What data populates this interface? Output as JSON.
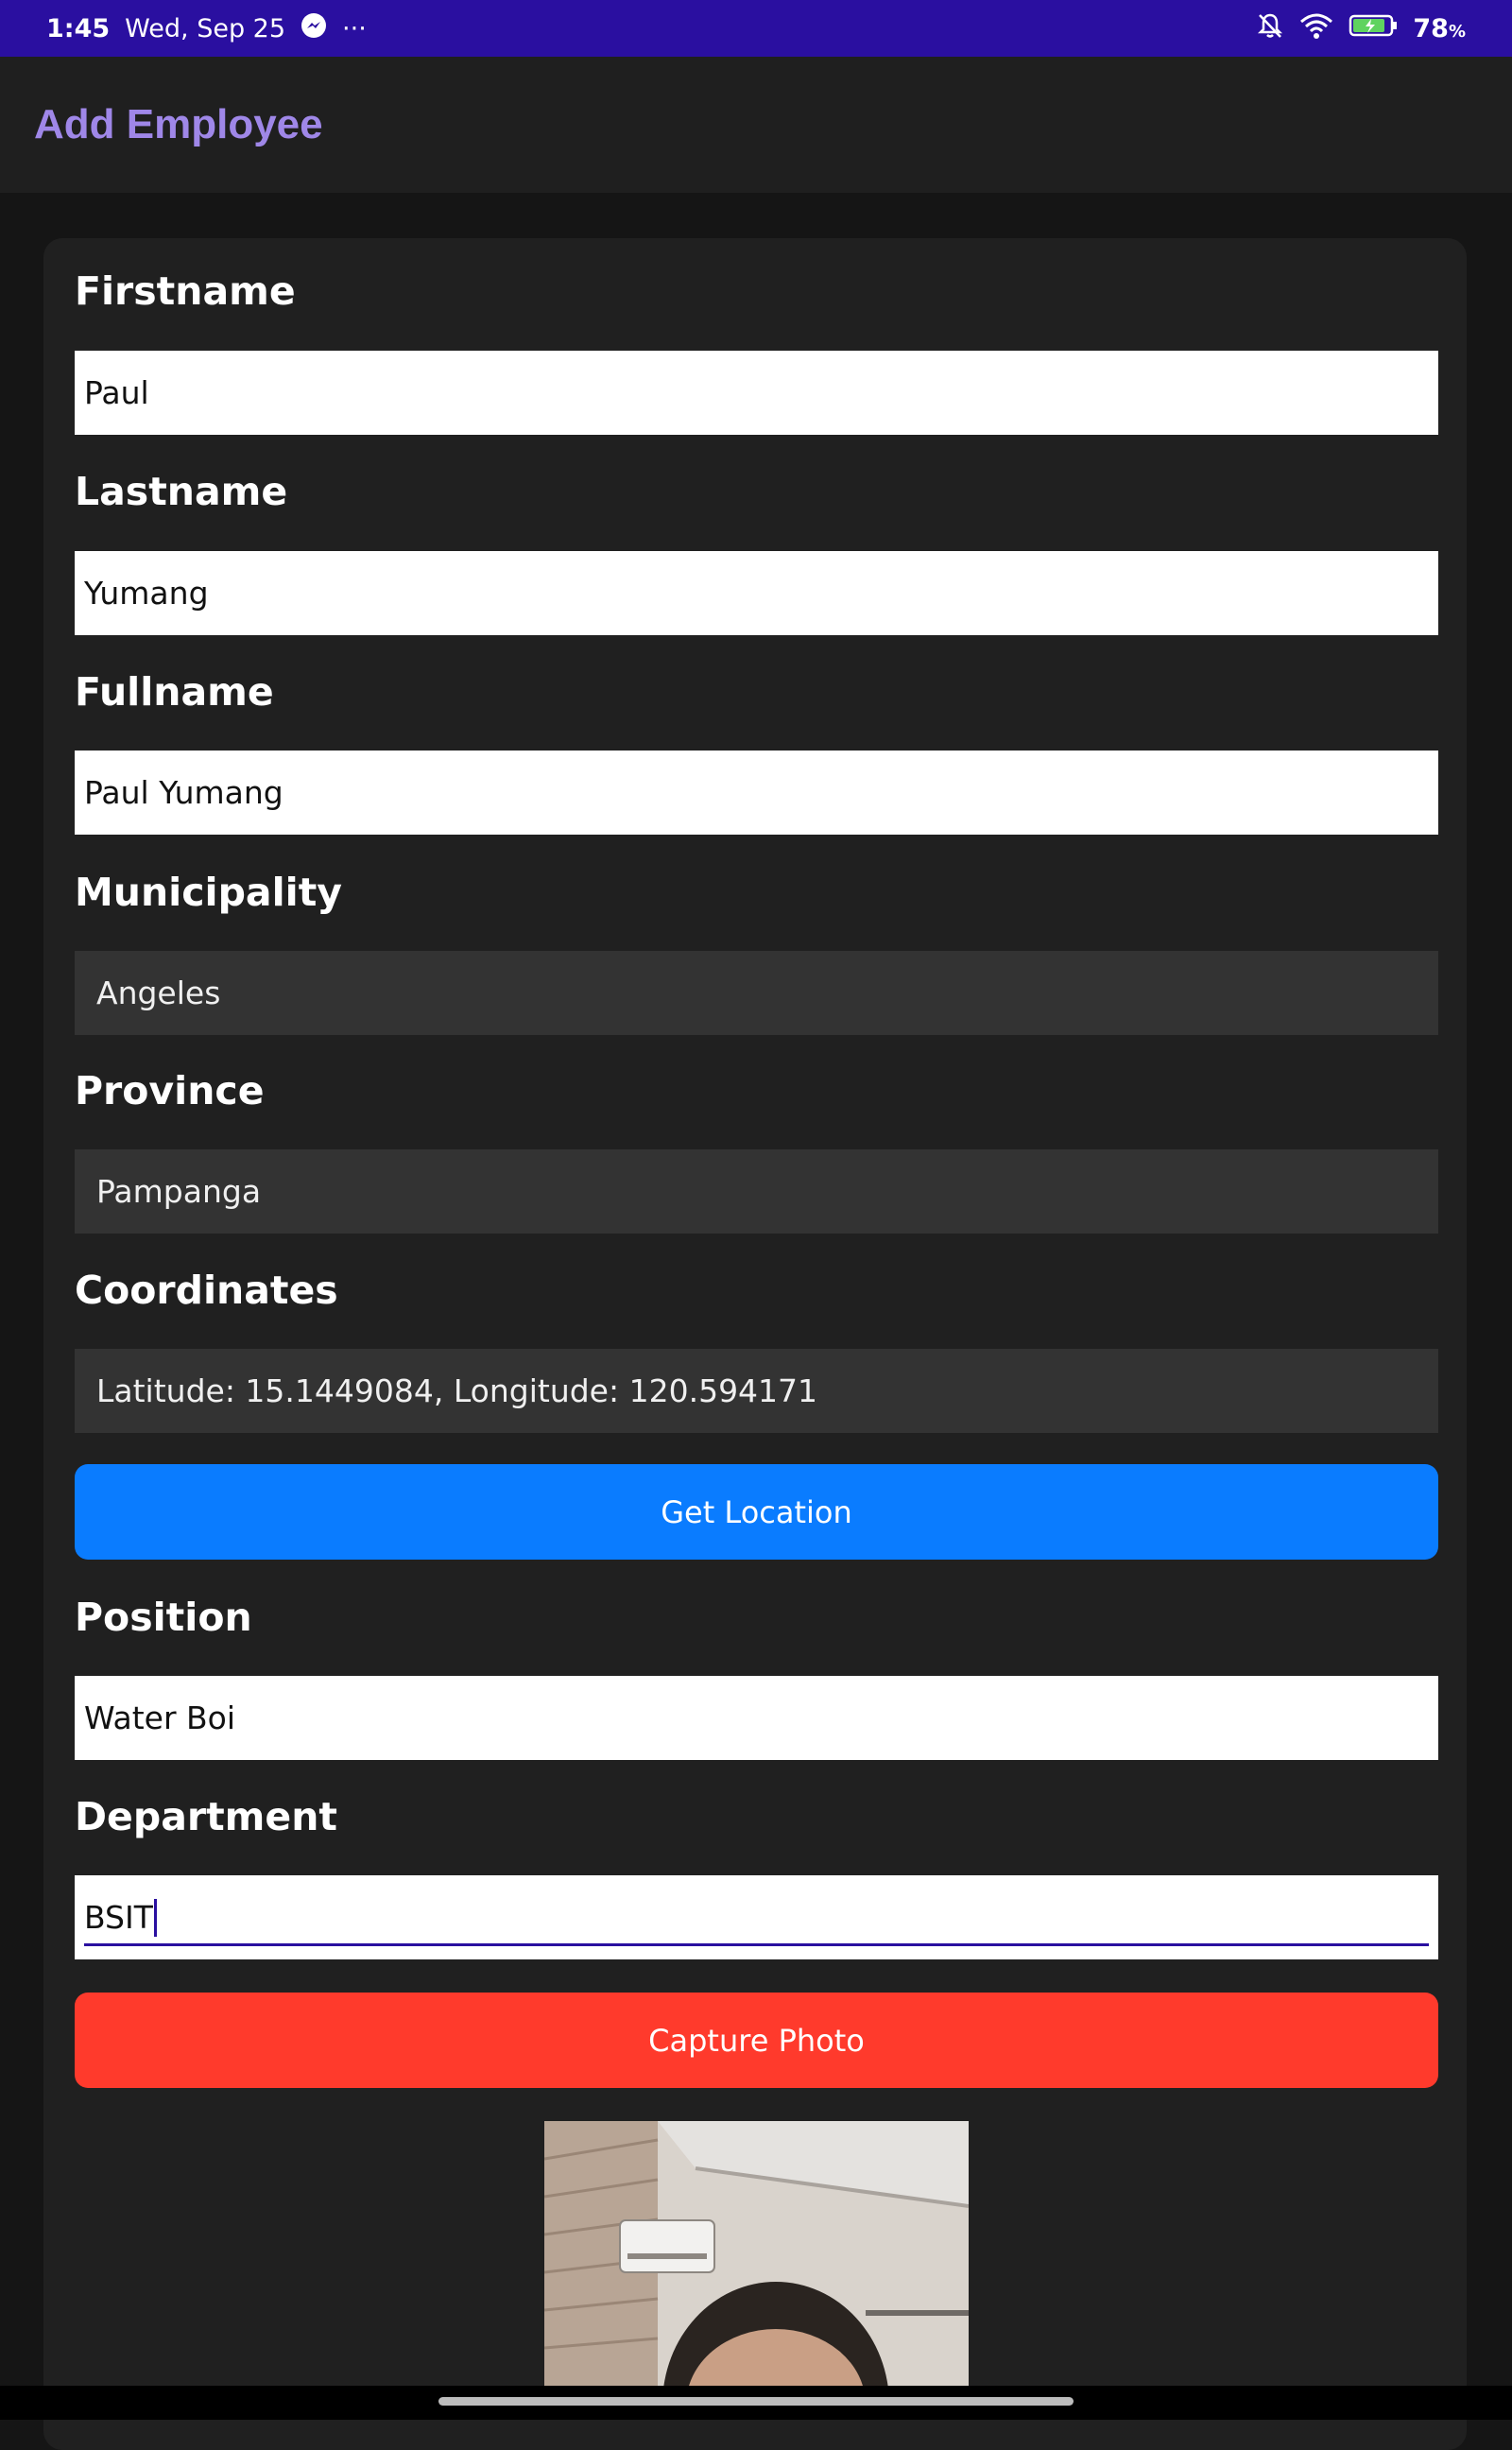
{
  "status_bar": {
    "time": "1:45",
    "date": "Wed, Sep 25",
    "more": "···",
    "battery_pct": "78",
    "battery_unit": "%",
    "icons": [
      "messenger-icon",
      "bell-off-icon",
      "wifi-icon",
      "battery-charging-icon"
    ]
  },
  "app_bar": {
    "title": "Add Employee",
    "title_color": "#9f87e8"
  },
  "form": {
    "firstname": {
      "label": "Firstname",
      "value": "Paul"
    },
    "lastname": {
      "label": "Lastname",
      "value": "Yumang"
    },
    "fullname": {
      "label": "Fullname",
      "value": "Paul Yumang"
    },
    "municipality": {
      "label": "Municipality",
      "value": "Angeles"
    },
    "province": {
      "label": "Province",
      "value": "Pampanga"
    },
    "coordinates": {
      "label": "Coordinates",
      "value": "Latitude: 15.1449084, Longitude: 120.594171"
    },
    "get_location_label": "Get Location",
    "position": {
      "label": "Position",
      "value": "Water Boi"
    },
    "department": {
      "label": "Department",
      "value": "BSIT"
    },
    "capture_photo_label": "Capture Photo"
  },
  "colors": {
    "status_bar": "#2a0fa0",
    "primary_button": "#0a7cff",
    "danger_button": "#ff3a2c",
    "focus_accent": "#2a0fa0"
  }
}
